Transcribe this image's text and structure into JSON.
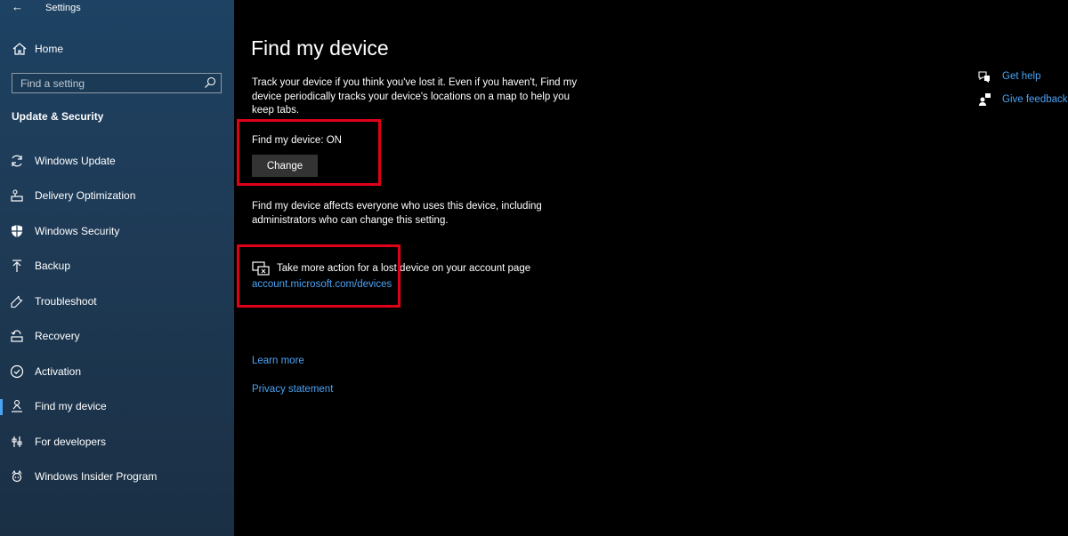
{
  "window": {
    "title": "Settings"
  },
  "sidebar": {
    "home_label": "Home",
    "search_placeholder": "Find a setting",
    "section_title": "Update & Security",
    "items": [
      {
        "label": "Windows Update",
        "icon": "refresh-icon"
      },
      {
        "label": "Delivery Optimization",
        "icon": "delivery-icon"
      },
      {
        "label": "Windows Security",
        "icon": "shield-icon"
      },
      {
        "label": "Backup",
        "icon": "backup-icon"
      },
      {
        "label": "Troubleshoot",
        "icon": "wrench-icon"
      },
      {
        "label": "Recovery",
        "icon": "recovery-icon"
      },
      {
        "label": "Activation",
        "icon": "check-circle-icon"
      },
      {
        "label": "Find my device",
        "icon": "person-location-icon",
        "active": true
      },
      {
        "label": "For developers",
        "icon": "developer-icon"
      },
      {
        "label": "Windows Insider Program",
        "icon": "insider-icon"
      }
    ]
  },
  "main": {
    "title": "Find my device",
    "intro": "Track your device if you think you've lost it. Even if you haven't, Find my device periodically tracks your device's locations on a map to help you keep tabs.",
    "status": "Find my device: ON",
    "change_label": "Change",
    "affects": "Find my device affects everyone who uses this device, including administrators who can change this setting.",
    "action_text": "Take more action for a lost device on your account page",
    "account_link": "account.microsoft.com/devices",
    "learn_more": "Learn more",
    "privacy": "Privacy statement"
  },
  "right": {
    "help": "Get help",
    "feedback": "Give feedback"
  },
  "colors": {
    "accent": "#4aa3f5",
    "highlight": "#e0001a",
    "sidebar_bg": "#1d4263",
    "main_bg": "#000000"
  }
}
